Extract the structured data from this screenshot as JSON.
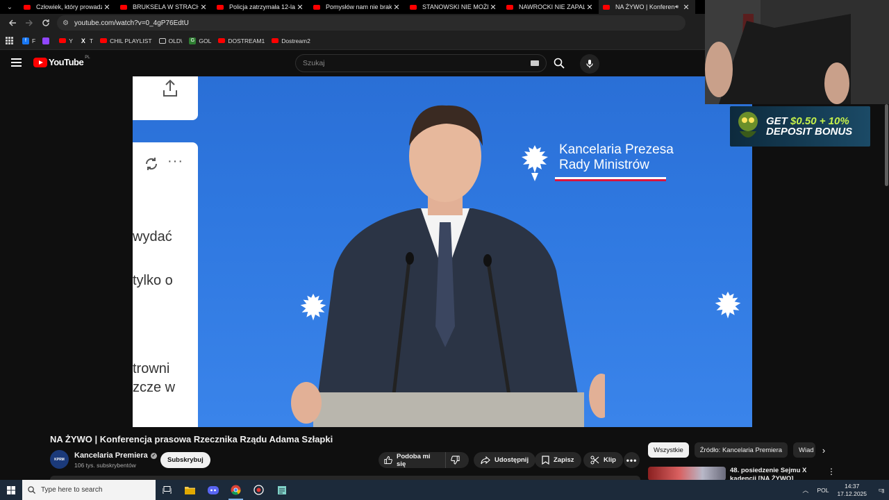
{
  "browser": {
    "tabs": [
      {
        "title": "Człowiek, który prowadzi",
        "active": false
      },
      {
        "title": "BRUKSELA W STRACHU. W",
        "active": false
      },
      {
        "title": "Policja zatrzymała 12-latk",
        "active": false
      },
      {
        "title": "Pomysłów nam nie braku",
        "active": false
      },
      {
        "title": "STANOWSKI NIE MOŻE U",
        "active": false
      },
      {
        "title": "NAWROCKI NIE ZAPALI C",
        "active": false
      },
      {
        "title": "NA ŻYWO | Konferen",
        "active": true
      }
    ],
    "url": "youtube.com/watch?v=0_4gP76EdtU",
    "bookmarks": [
      {
        "label": "F",
        "icon": "facebook-icon"
      },
      {
        "label": "",
        "icon": "twitch-icon"
      },
      {
        "label": "Y",
        "icon": "youtube-icon"
      },
      {
        "label": "T",
        "icon": "x-icon"
      },
      {
        "label": "CHIL PLAYLIST",
        "icon": "youtube-icon"
      },
      {
        "label": "OLD\\",
        "icon": "folder-icon"
      },
      {
        "label": "GOL",
        "icon": "g-icon"
      },
      {
        "label": "DOSTREAM1",
        "icon": "youtube-icon"
      },
      {
        "label": "Dostream2",
        "icon": "youtube-icon"
      }
    ]
  },
  "youtube": {
    "logo_text": "YouTube",
    "country_code": "PL",
    "search_placeholder": "Szukaj"
  },
  "video": {
    "overlay_text": [
      "wydać",
      "tylko o",
      "trowni",
      "zcze w"
    ],
    "backdrop_org_line1": "Kancelaria Prezesa",
    "backdrop_org_line2": "Rady Ministrów"
  },
  "promo": {
    "line1_a": "GET ",
    "line1_b": "$0.50 + 10%",
    "line2": "DEPOSIT BONUS"
  },
  "watch": {
    "title": "NA ŻYWO | Konferencja prasowa Rzecznika Rządu Adama Szłapki",
    "channel_avatar_text": "KPRM",
    "channel_name": "Kancelaria Premiera",
    "subscribers": "106 tys. subskrybentów",
    "subscribe_label": "Subskrybuj",
    "actions": {
      "like": "Podoba mi się",
      "share": "Udostępnij",
      "save": "Zapisz",
      "clip": "Klip"
    }
  },
  "sidebar": {
    "chips": [
      "Wszystkie",
      "Źródło: Kancelaria Premiera",
      "Wiad"
    ],
    "recommendation_title": "48. posiedzenie Sejmu X kadencji [NA ŻYWO]"
  },
  "taskbar": {
    "search_placeholder": "Type here to search",
    "language": "POL",
    "time": "14:37",
    "date": "17.12.2025",
    "notification_count": "3"
  },
  "colors": {
    "youtube_red": "#ff0000",
    "video_background_blue": "#2f78e0",
    "promo_highlight": "#c6f14b"
  }
}
